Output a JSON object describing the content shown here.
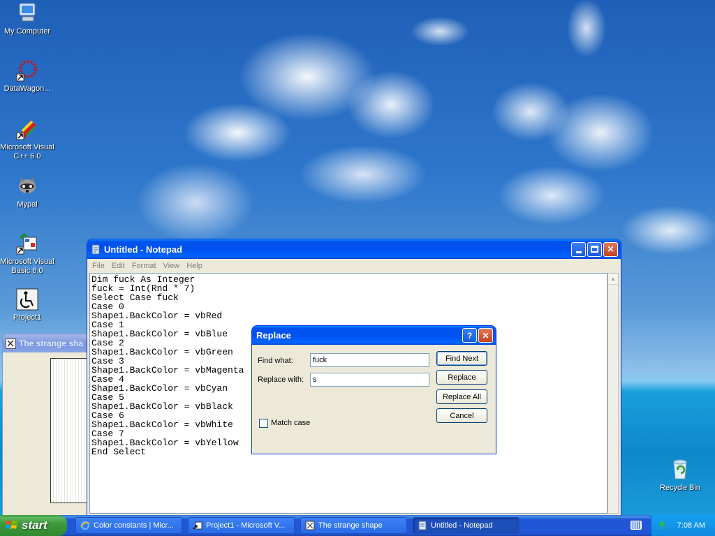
{
  "desktop": {
    "icons": [
      {
        "label": "My Computer",
        "icon": "computer-icon"
      },
      {
        "label": "DataWagon...",
        "icon": "datawagon-icon"
      },
      {
        "label": "Microsoft Visual C++ 6.0",
        "icon": "visual-cpp-icon"
      },
      {
        "label": "Mypal",
        "icon": "mypal-icon"
      },
      {
        "label": "Microsoft Visual Basic 6.0",
        "icon": "visual-basic-icon"
      },
      {
        "label": "Project1",
        "icon": "accessibility-icon"
      },
      {
        "label": "Recycle Bin",
        "icon": "recycle-bin-icon"
      }
    ]
  },
  "background_window": {
    "title": "The strange sha"
  },
  "notepad": {
    "title": "Untitled - Notepad",
    "menu": [
      "File",
      "Edit",
      "Format",
      "View",
      "Help"
    ],
    "text": "Dim fuck As Integer\nfuck = Int(Rnd * 7)\nSelect Case fuck\nCase 0\nShape1.BackColor = vbRed\nCase 1\nShape1.BackColor = vbBlue\nCase 2\nShape1.BackColor = vbGreen\nCase 3\nShape1.BackColor = vbMagenta\nCase 4\nShape1.BackColor = vbCyan\nCase 5\nShape1.BackColor = vbBlack\nCase 6\nShape1.BackColor = vbWhite\nCase 7\nShape1.BackColor = vbYellow\nEnd Select"
  },
  "replace_dialog": {
    "title": "Replace",
    "find_label": "Find what:",
    "find_value": "fuck",
    "replace_label": "Replace with:",
    "replace_value": "s",
    "match_case_label": "Match case",
    "buttons": {
      "find_next": "Find Next",
      "replace": "Replace",
      "replace_all": "Replace All",
      "cancel": "Cancel"
    },
    "help_glyph": "?"
  },
  "taskbar": {
    "start_label": "start",
    "tasks": [
      {
        "label": "Color constants | Micr...",
        "icon": "ie-icon"
      },
      {
        "label": "Project1 - Microsoft V...",
        "icon": "vb-icon"
      },
      {
        "label": "The strange shape",
        "icon": "form-icon"
      },
      {
        "label": "Untitled - Notepad",
        "icon": "notepad-icon"
      }
    ],
    "clock": "7:08 AM"
  },
  "colors": {
    "xp_blue": "#0053ee",
    "start_green": "#3f9a3f"
  }
}
